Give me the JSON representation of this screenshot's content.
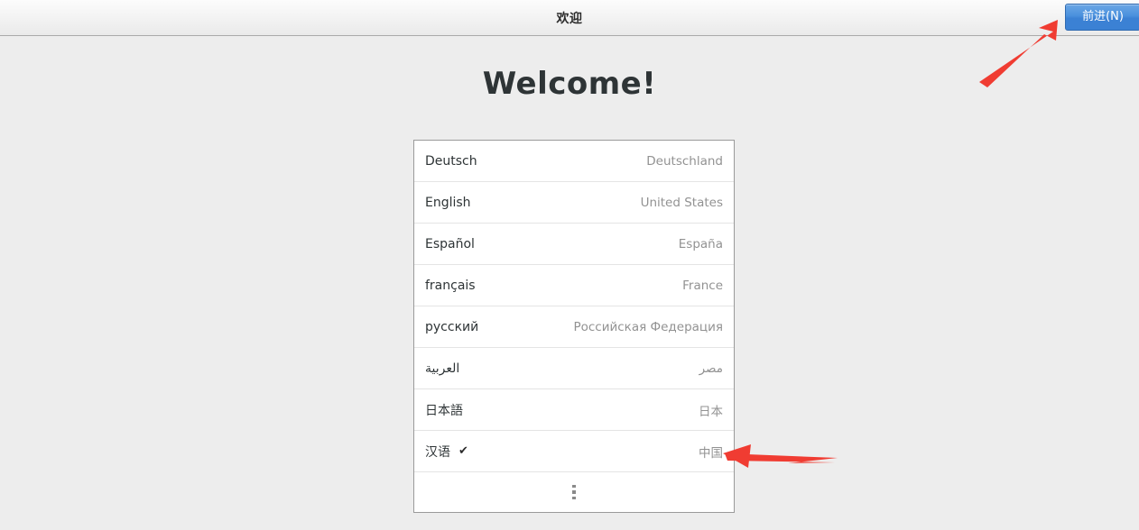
{
  "window": {
    "title": "欢迎",
    "next_button_label": "前进(N)"
  },
  "main": {
    "heading": "Welcome!",
    "languages": [
      {
        "name": "Deutsch",
        "region": "Deutschland",
        "selected": false,
        "rtl": false
      },
      {
        "name": "English",
        "region": "United States",
        "selected": false,
        "rtl": false
      },
      {
        "name": "Español",
        "region": "España",
        "selected": false,
        "rtl": false
      },
      {
        "name": "français",
        "region": "France",
        "selected": false,
        "rtl": false
      },
      {
        "name": "русский",
        "region": "Российская Федерация",
        "selected": false,
        "rtl": false
      },
      {
        "name": "العربية",
        "region": "مصر",
        "selected": false,
        "rtl": true
      },
      {
        "name": "日本語",
        "region": "日本",
        "selected": false,
        "rtl": false
      },
      {
        "name": "汉语",
        "region": "中国",
        "selected": true,
        "rtl": false
      }
    ],
    "selected_mark": "✔",
    "more_icon": "more-vertical-icon"
  },
  "annotations": [
    {
      "name": "arrow-to-next-button",
      "color": "#f03c32"
    },
    {
      "name": "arrow-to-selected-language",
      "color": "#f03c32"
    }
  ],
  "colors": {
    "accent": "#3b81d4",
    "background": "#ededed",
    "card": "#ffffff",
    "text": "#2e3436",
    "muted": "#929292",
    "annotation": "#f03c32"
  }
}
